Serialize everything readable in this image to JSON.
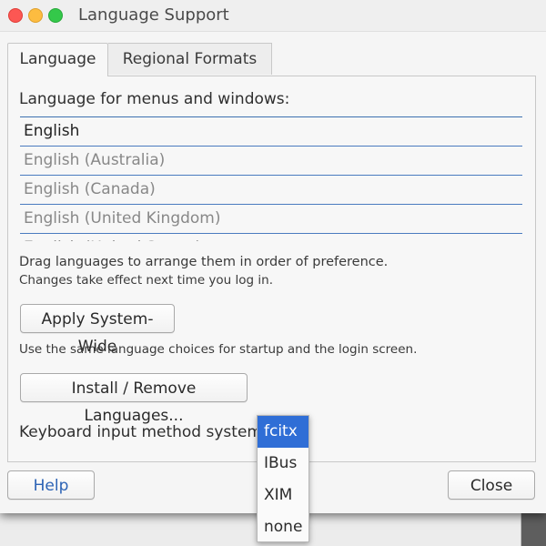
{
  "window": {
    "title": "Language Support"
  },
  "tabs": [
    {
      "label": "Language",
      "active": true
    },
    {
      "label": "Regional Formats",
      "active": false
    }
  ],
  "language_section": {
    "label": "Language for menus and windows:",
    "languages": [
      "English",
      "English (Australia)",
      "English (Canada)",
      "English (United Kingdom)",
      "English (United States)"
    ],
    "drag_hint": "Drag languages to arrange them in order of preference.",
    "effect_hint": "Changes take effect next time you log in."
  },
  "buttons": {
    "apply": "Apply System-Wide",
    "install": "Install / Remove Languages...",
    "help": "Help",
    "close": "Close"
  },
  "system_hint": "Use the same language choices for startup and the login screen.",
  "keyboard": {
    "label": "Keyboard input method system:",
    "options": [
      "fcitx",
      "IBus",
      "XIM",
      "none"
    ],
    "selected": "fcitx"
  },
  "colors": {
    "selection": "#2f6ed6",
    "list_divider": "#4a7bbf",
    "help_text": "#2c63b5"
  }
}
